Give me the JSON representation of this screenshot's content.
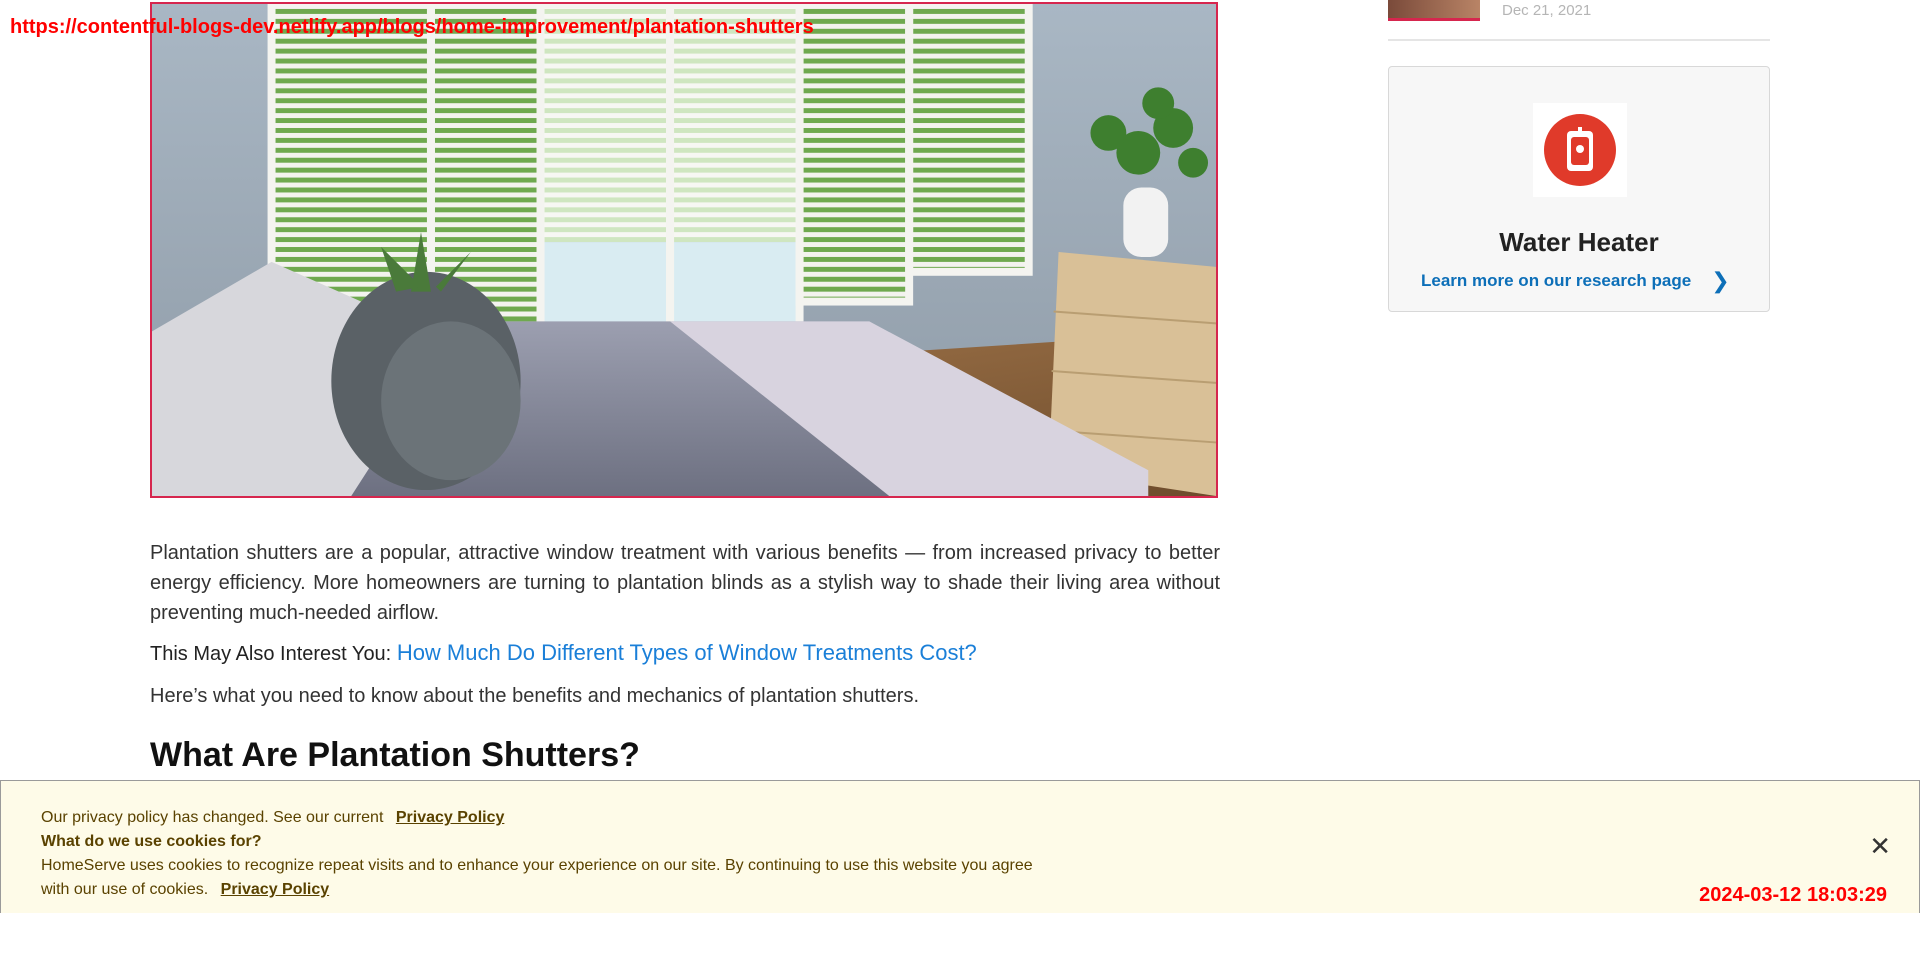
{
  "overlay": {
    "url": "https://contentful-blogs-dev.netlify.app/blogs/home-improvement/plantation-shutters",
    "timestamp": "2024-03-12 18:03:29"
  },
  "hero": {
    "alt": "Bedroom with white plantation shutters"
  },
  "article": {
    "intro": "Plantation shutters are a popular, attractive window treatment with various benefits — from increased privacy to better energy efficiency. More homeowners are turning to plantation blinds as a stylish way to shade their living area without preventing much-needed airflow.",
    "also_interest_lead": "This May Also Interest You:",
    "also_interest_link": "How Much Do Different Types of Window Treatments Cost?",
    "what_to_know": "Here’s what you need to know about the benefits and mechanics of plantation shutters.",
    "heading": "What Are Plantation Shutters?"
  },
  "sidebar": {
    "prev_date": "Dec 21, 2021",
    "card": {
      "title": "Water Heater",
      "link": "Learn more on our research page",
      "icon": "water-heater-icon",
      "icon_color": "#e03a2a"
    }
  },
  "cookie": {
    "line1": "Our privacy policy has changed. See our current",
    "link1": "Privacy Policy",
    "question": "What do we use cookies for?",
    "body": "HomeServe uses cookies to recognize repeat visits and to enhance your experience on our site. By continuing to use this website you agree with our use of cookies.",
    "link2": "Privacy Policy",
    "close": "✕"
  }
}
